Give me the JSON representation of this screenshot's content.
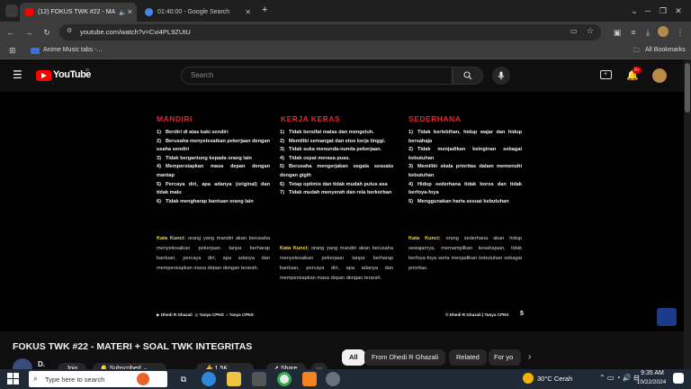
{
  "browser": {
    "tabs": [
      {
        "label": "(12) FOKUS TWK #22 - MA",
        "favicon_color": "#ff0000",
        "active": true
      },
      {
        "label": "01:40:00 - Google Search",
        "favicon_color": "#4285f4",
        "active": false
      }
    ],
    "new_tab": "+",
    "address": "youtube.com/watch?v=Cvi4PL9ZUtU",
    "bookmarks": [
      {
        "label": "Anime Music tabs -..."
      }
    ],
    "all_bookmarks": "All Bookmarks"
  },
  "youtube": {
    "logo": "YouTube",
    "logo_region": "ID",
    "search_placeholder": "Search",
    "notification_count": "9+"
  },
  "slide": {
    "columns": [
      {
        "heading": "MANDIRI",
        "items": [
          {
            "n": "1)",
            "text": "Berdiri di atas kaki sendiri"
          },
          {
            "n": "2)",
            "text": "Berusaha menyelesaikan pekerjaan dengan usaha sendiri"
          },
          {
            "n": "3)",
            "text": "Tidak bergantung kepada orang lain"
          },
          {
            "n": "4)",
            "text": "Mempersiapkan masa depan dengan mantap"
          },
          {
            "n": "5)",
            "text": "Percaya diri, apa adanya (original) dan tidak malu"
          },
          {
            "n": "6)",
            "text": "Tidak mengharap bantuan orang lain"
          }
        ],
        "kata_kunci_label": "Kata Kunci:",
        "kata_kunci_text": "orang yang mandiri akan berusaha menyelesaikan pekerjaan tanpa berharap bantuan, percaya diri, apa adanya dan mempersiapkan masa depan dengan terarah."
      },
      {
        "heading": "KERJA KERAS",
        "items": [
          {
            "n": "1)",
            "text": "Tidak bersifat malas dan mengeluh."
          },
          {
            "n": "2)",
            "text": "Memiliki semangat dan etos kerja tinggi."
          },
          {
            "n": "3)",
            "text": "Tidak suka menunda-nunda pekerjaan."
          },
          {
            "n": "4)",
            "text": "Tidak cepat merasa puas."
          },
          {
            "n": "5)",
            "text": "Berusaha mengerjakan segala sesuatu dengan gigih"
          },
          {
            "n": "6)",
            "text": "Tetap optimis dan tidak mudah putus asa"
          },
          {
            "n": "7)",
            "text": "Tidak mudah menyerah dan rela berkorban"
          }
        ],
        "kata_kunci_label": "Kata Kunci:",
        "kata_kunci_text": "orang yang mandiri akan berusaha menyelesaikan pekerjaan tanpa berharap bantuan, percaya diri, apa adanya dan mempersiapkan masa depan dengan terarah."
      },
      {
        "heading": "SEDERHANA",
        "items": [
          {
            "n": "1)",
            "text": "Tidak berlebihan, hidup wajar dan hidup bersahaja"
          },
          {
            "n": "2)",
            "text": "Tidak menjadikan keinginan sebagai kebutuhan"
          },
          {
            "n": "3)",
            "text": "Memiliki skala prioritas dalam memenuhi kebutuhan"
          },
          {
            "n": "4)",
            "text": "Hidup sederhana tidak boros dan tidak berfoya-foya"
          },
          {
            "n": "5)",
            "text": "Menggunakan harta sesuai kebutuhan"
          }
        ],
        "kata_kunci_label": "Kata Kunci:",
        "kata_kunci_text": "orang sederhana akan hidup sewajarnya, memampilkan kesahajaan, tidak berfoya-foya serta menjadikan kebutuhan sebagai prioritas."
      }
    ],
    "footer_left": [
      "Dhedi R Ghazali",
      "Tanya CPNS",
      "Tanya CPNS"
    ],
    "footer_right": "© Dhedi R Ghazali | Tanya CPNS",
    "page_number": "5"
  },
  "video_info": {
    "title": "FOKUS TWK #22 - MATERI + SOAL TWK INTEGRITAS",
    "channel_initial": "D.",
    "join": "Join",
    "subscribed": "Subscribed",
    "likes": "1.5K",
    "share": "Share"
  },
  "chips": [
    {
      "label": "All",
      "selected": true
    },
    {
      "label": "From Dhedi R Ghazali",
      "selected": false
    },
    {
      "label": "Related",
      "selected": false
    },
    {
      "label": "For yo",
      "selected": false
    }
  ],
  "taskbar": {
    "search_placeholder": "Type here to search",
    "weather": "30°C  Cerah",
    "time": "9:35 AM",
    "date": "10/22/2024"
  }
}
